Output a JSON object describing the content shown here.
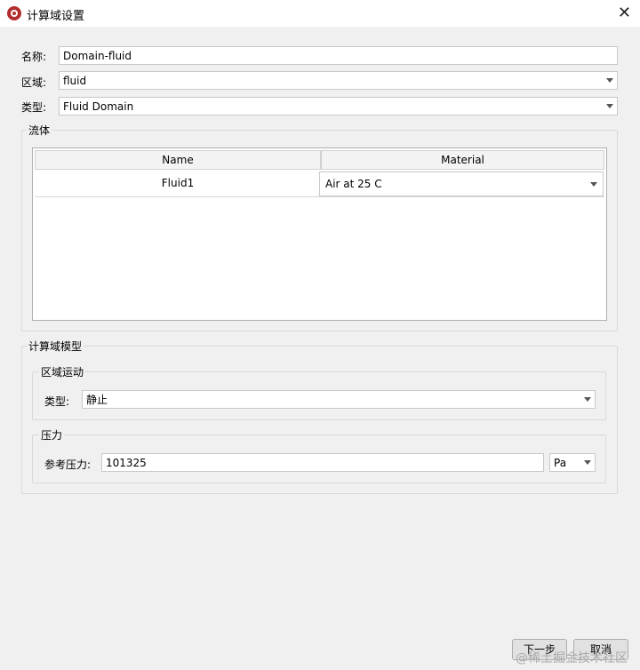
{
  "window": {
    "title": "计算域设置",
    "close_glyph": "✕"
  },
  "form": {
    "name_label": "名称:",
    "name_value": "Domain-fluid",
    "region_label": "区域:",
    "region_value": "fluid",
    "type_label": "类型:",
    "type_value": "Fluid Domain"
  },
  "fluids": {
    "group_title": "流体",
    "columns": [
      "Name",
      "Material"
    ],
    "rows": [
      {
        "name": "Fluid1",
        "material": "Air at 25 C"
      }
    ]
  },
  "model": {
    "group_title": "计算域模型",
    "motion": {
      "group_title": "区域运动",
      "type_label": "类型:",
      "type_value": "静止"
    },
    "pressure": {
      "group_title": "压力",
      "ref_label": "参考压力:",
      "ref_value": "101325",
      "unit_value": "Pa"
    }
  },
  "buttons": {
    "next": "下一步",
    "cancel": "取消"
  },
  "watermark": "@稀土掘金技术社区",
  "colors": {
    "accent_icon": "#b32d2e",
    "background": "#f0f0f0"
  }
}
